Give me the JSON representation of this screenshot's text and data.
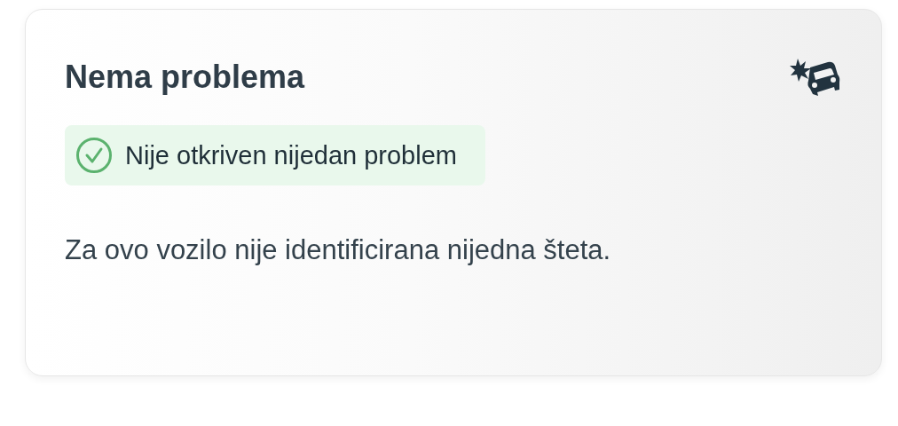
{
  "card": {
    "title": "Nema problema",
    "status": {
      "kind": "ok",
      "text": "Nije otkriven nijedan problem"
    },
    "description": "Za ovo vozilo nije identificirana nijedna šteta."
  }
}
